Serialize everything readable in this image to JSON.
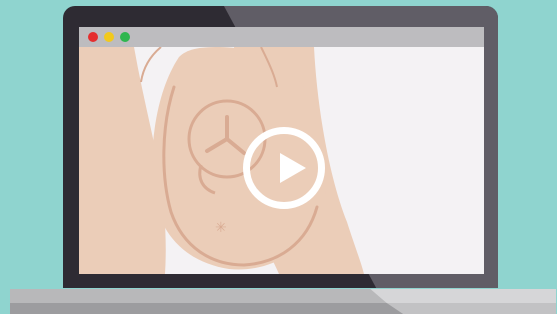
{
  "colors": {
    "background": "#8fd4cf",
    "lid_dark": "#2e2b33",
    "lid_light": "#605d66",
    "titlebar": "#bdbcbf",
    "video_bg": "#f4f2f4",
    "skin": "#ebcdb8",
    "skin_shadow": "#d9ab93",
    "base_top": "#b8b8ba",
    "base_top_light": "#d6d6d8",
    "base_bottom": "#9c9c9f",
    "base_bottom_light": "#c2c2c4",
    "play_button": "#ffffff"
  },
  "window_controls": [
    {
      "name": "close",
      "color": "#e52e2e"
    },
    {
      "name": "minimize",
      "color": "#f2c91c"
    },
    {
      "name": "maximize",
      "color": "#2fb64f"
    }
  ],
  "video": {
    "icon": "play-icon",
    "state": "paused",
    "thumbnail": "pregnant-belly-cross-section-illustration"
  }
}
